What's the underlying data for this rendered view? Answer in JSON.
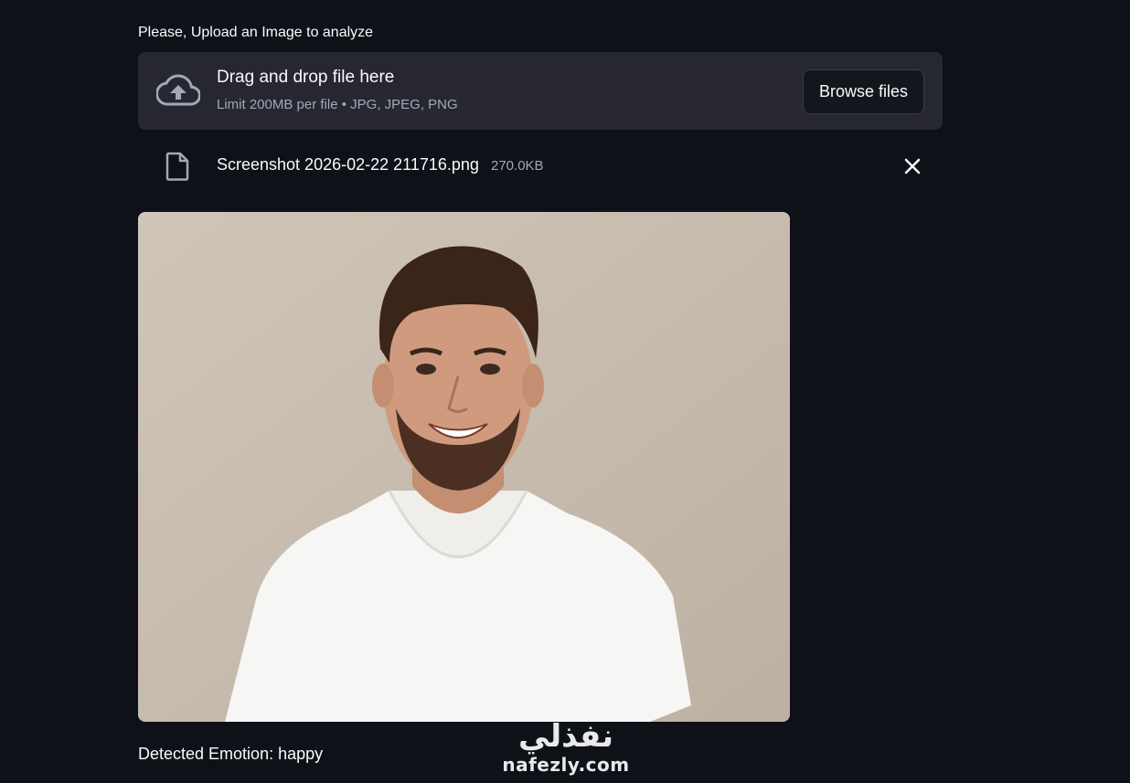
{
  "uploader": {
    "label": "Please, Upload an Image to analyze",
    "dropzone_title": "Drag and drop file here",
    "dropzone_limit": "Limit 200MB per file • JPG, JPEG, PNG",
    "browse_label": "Browse files",
    "icon": "cloud-upload-icon"
  },
  "uploaded_file": {
    "name": "Screenshot 2026-02-22 211716.png",
    "size": "270.0KB",
    "icon": "file-icon",
    "remove_icon": "close-icon"
  },
  "preview": {
    "alt": "Uploaded photo of a smiling man in a white t-shirt"
  },
  "result": {
    "text": "Detected Emotion: happy"
  },
  "watermark": {
    "arabic": "نفذلي",
    "latin": "nafezly.com"
  },
  "colors": {
    "background": "#0e1117",
    "dropzone": "#262730",
    "muted_text": "#a3a8b8"
  }
}
